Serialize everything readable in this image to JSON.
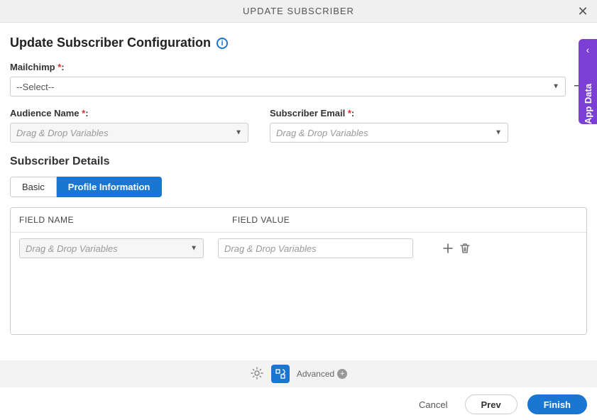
{
  "header": {
    "title": "UPDATE SUBSCRIBER"
  },
  "sideTab": {
    "label": "App Data"
  },
  "page": {
    "title": "Update Subscriber Configuration"
  },
  "fields": {
    "mailchimp": {
      "label": "Mailchimp",
      "value": "--Select--"
    },
    "audienceName": {
      "label": "Audience Name",
      "placeholder": "Drag & Drop Variables"
    },
    "subscriberEmail": {
      "label": "Subscriber Email",
      "placeholder": "Drag & Drop Variables"
    }
  },
  "subscriberDetails": {
    "heading": "Subscriber Details",
    "tabs": {
      "basic": "Basic",
      "profile": "Profile Information"
    },
    "columns": {
      "fieldName": "FIELD NAME",
      "fieldValue": "FIELD VALUE"
    },
    "row": {
      "namePlaceholder": "Drag & Drop Variables",
      "valuePlaceholder": "Drag & Drop Variables"
    }
  },
  "footer": {
    "advanced": "Advanced"
  },
  "buttons": {
    "cancel": "Cancel",
    "prev": "Prev",
    "finish": "Finish"
  }
}
